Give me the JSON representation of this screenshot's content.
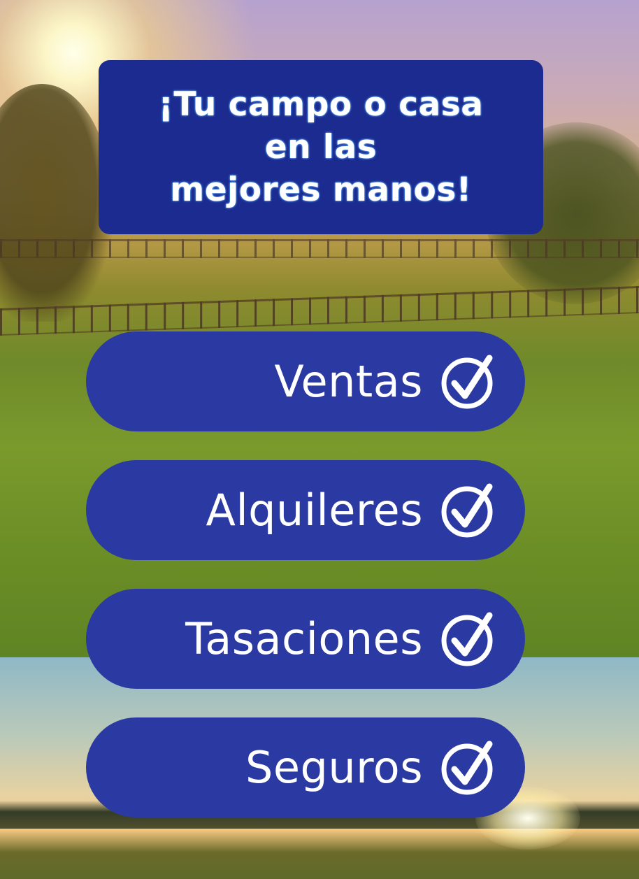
{
  "headline": {
    "lines": [
      "¡Tu campo o casa",
      "en las",
      "mejores manos!"
    ]
  },
  "services": [
    {
      "label": "Ventas",
      "icon": "check-circle-icon"
    },
    {
      "label": "Alquileres",
      "icon": "check-circle-icon"
    },
    {
      "label": "Tasaciones",
      "icon": "check-circle-icon"
    },
    {
      "label": "Seguros",
      "icon": "check-circle-icon"
    }
  ],
  "colors": {
    "headline_bg": "#1c2b8f",
    "pill_bg": "#2b3aa2",
    "text": "#ffffff"
  }
}
